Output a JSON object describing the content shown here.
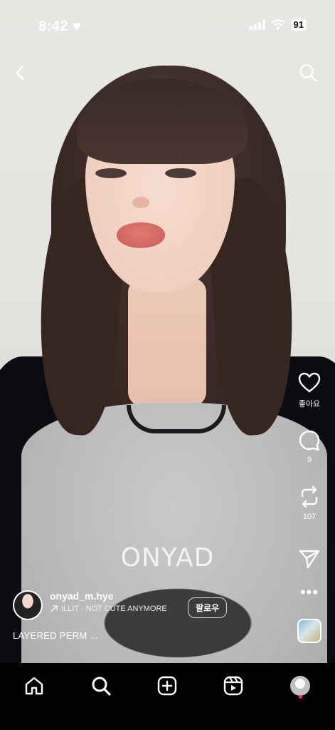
{
  "status_bar": {
    "time": "8:42",
    "battery": "91"
  },
  "overlay": {
    "watermark": "ONYAD"
  },
  "side_actions": {
    "like_label": "좋아요",
    "comment_count": "9",
    "repost_count": "107"
  },
  "author": {
    "username": "onyad_m.hye",
    "audio": "ILLIT · NOT CUTE ANYMORE",
    "follow_label": "팔로우",
    "caption": "LAYERED PERM ..."
  },
  "icons": {
    "back": "chevron-left-icon",
    "search": "search-icon",
    "like": "heart-icon",
    "comment": "comment-icon",
    "repost": "repost-icon",
    "share": "send-icon",
    "more": "more-icon",
    "home": "home-icon",
    "explore": "search-icon",
    "create": "plus-square-icon",
    "reels": "reels-icon",
    "profile": "profile-avatar"
  },
  "colors": {
    "notification_dot": "#ff3040",
    "tabbar_bg": "#000000"
  }
}
